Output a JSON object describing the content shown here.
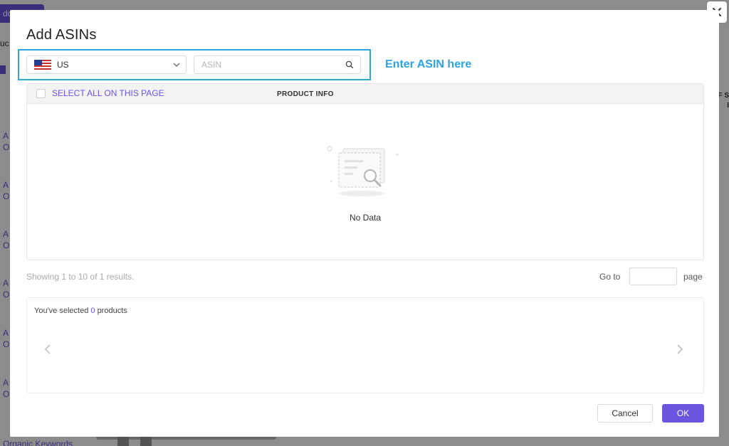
{
  "background": {
    "add_button_label": "dd",
    "partial_label": "uc",
    "row_links": [
      "A",
      "O",
      "A",
      "O",
      "A",
      "O",
      "A",
      "O",
      "A",
      "O",
      "A",
      "O"
    ],
    "bottom_link": "Organic Keywords",
    "right_header": [
      "F S",
      "I"
    ]
  },
  "modal": {
    "title": "Add ASINs",
    "annotation": "Enter ASIN here",
    "marketplace": {
      "selected": "US",
      "flag": "us-flag"
    },
    "asin_input": {
      "value": "",
      "placeholder": "ASIN"
    },
    "table": {
      "select_all_label": "SELECT ALL ON THIS PAGE",
      "column_header": "PRODUCT INFO",
      "empty_text": "No Data"
    },
    "pagination": {
      "showing_text": "Showing 1 to 10 of 1 results.",
      "goto_label": "Go to",
      "goto_value": "",
      "page_label": "page"
    },
    "selected": {
      "prefix": "You've selected",
      "count": "0",
      "suffix": "products"
    },
    "buttons": {
      "cancel": "Cancel",
      "ok": "OK"
    },
    "colors": {
      "accent": "#6a54e0",
      "highlight": "#2ea3dd"
    }
  }
}
